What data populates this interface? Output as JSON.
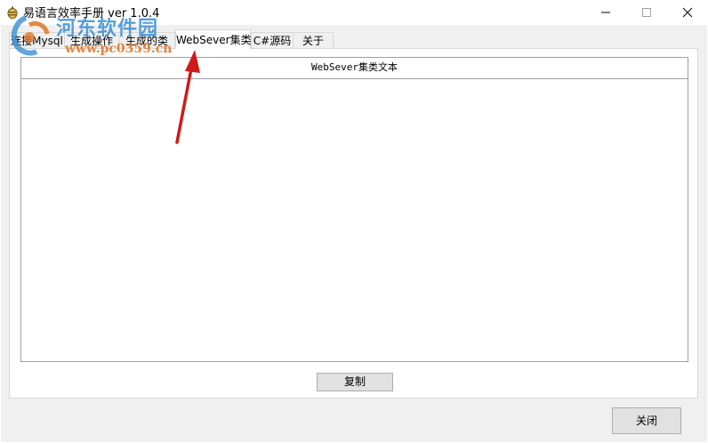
{
  "window": {
    "title": "易语言效率手册 ver 1.0.4",
    "icons": {
      "app": "app-icon",
      "minimize": "minimize-icon",
      "maximize": "maximize-icon",
      "close": "close-icon"
    }
  },
  "tabs": [
    {
      "label": "连接Mysql",
      "active": false
    },
    {
      "label": "生成操作",
      "active": false
    },
    {
      "label": "生成的类",
      "active": false
    },
    {
      "label": "WebSever集类",
      "active": true
    },
    {
      "label": "C#源码",
      "active": false
    },
    {
      "label": "关于",
      "active": false
    }
  ],
  "panel": {
    "header": "WebSever集类文本",
    "text_value": ""
  },
  "buttons": {
    "copy": "复制",
    "close": "关闭"
  },
  "watermark": {
    "site_name": "河东软件园",
    "url": "www.pc0359.cn"
  },
  "colors": {
    "arrow": "#d11a1a",
    "watermark_blue": "#3a8fd6",
    "watermark_orange": "#e0762a"
  }
}
